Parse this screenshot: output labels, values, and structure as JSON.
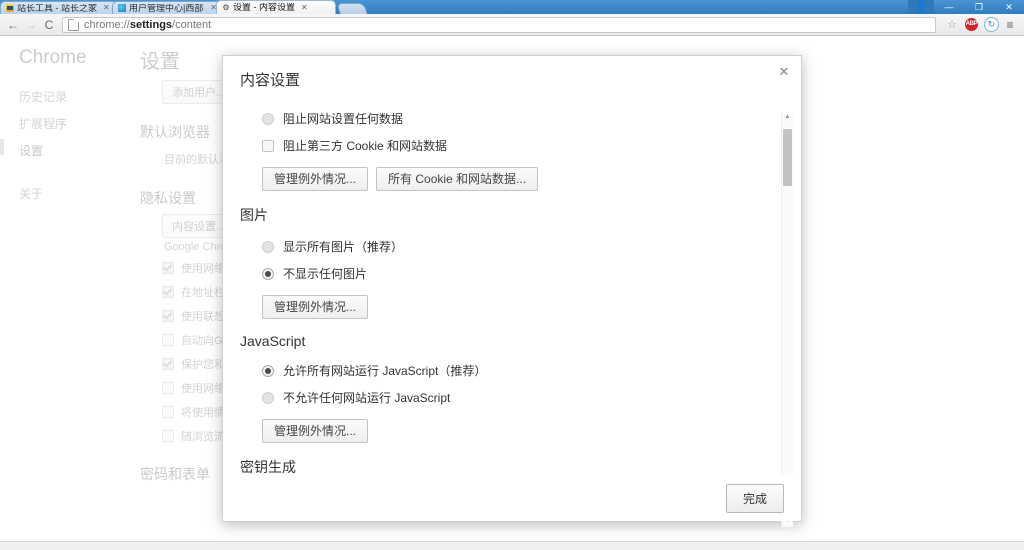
{
  "window": {
    "controls": {
      "user_icon": "user-account-icon",
      "minimize": "—",
      "maximize": "❐",
      "close": "✕"
    }
  },
  "tabs": [
    {
      "title": "站长工具 - 站长之家",
      "favicon": "site-tool-icon",
      "close": "✕",
      "active": false
    },
    {
      "title": "用户管理中心|西部数",
      "favicon": "user-center-icon",
      "close": "✕",
      "active": false
    },
    {
      "title": "设置 - 内容设置",
      "favicon": "gear-icon",
      "close": "✕",
      "active": true
    }
  ],
  "toolbar": {
    "back": "←",
    "forward": "→",
    "reload": "C",
    "url_prefix": "chrome://",
    "url_bold": "settings",
    "url_suffix": "/content",
    "star": "☆",
    "abp_label": "ABP",
    "sync": "↻",
    "menu": "≡"
  },
  "settings_page": {
    "brand": "Chrome",
    "nav": [
      {
        "label": "历史记录",
        "selected": false
      },
      {
        "label": "扩展程序",
        "selected": false
      },
      {
        "label": "设置",
        "selected": true
      },
      {
        "label": "关于",
        "selected": false
      }
    ],
    "title": "设置",
    "add_user_button": "添加用户...",
    "default_browser_heading": "默认浏览器",
    "default_browser_text": "目前的默认浏",
    "privacy_heading": "隐私设置",
    "content_settings_button": "内容设置...",
    "privacy_note": "Google Chro",
    "checkboxes": [
      {
        "label": "使用网络",
        "checked": true
      },
      {
        "label": "在地址栏",
        "checked": true
      },
      {
        "label": "使用联想",
        "checked": true
      },
      {
        "label": "自动向G",
        "checked": false
      },
      {
        "label": "保护您和",
        "checked": true
      },
      {
        "label": "使用网络",
        "checked": false
      },
      {
        "label": "将使用情",
        "checked": false
      },
      {
        "label": "随浏览流",
        "checked": false
      }
    ],
    "passwords_heading": "密码和表单"
  },
  "dialog": {
    "title": "内容设置",
    "close_label": "✕",
    "sections": [
      {
        "heading": null,
        "options": [
          {
            "type": "radio",
            "label": "阻止网站设置任何数据",
            "checked": false
          },
          {
            "type": "checkbox",
            "label": "阻止第三方 Cookie 和网站数据",
            "checked": false
          }
        ],
        "buttons": [
          "管理例外情况...",
          "所有 Cookie 和网站数据..."
        ]
      },
      {
        "heading": "图片",
        "options": [
          {
            "type": "radio",
            "label": "显示所有图片（推荐）",
            "checked": false
          },
          {
            "type": "radio",
            "label": "不显示任何图片",
            "checked": true
          }
        ],
        "buttons": [
          "管理例外情况..."
        ]
      },
      {
        "heading": "JavaScript",
        "options": [
          {
            "type": "radio",
            "label": "允许所有网站运行 JavaScript（推荐）",
            "checked": true
          },
          {
            "type": "radio",
            "label": "不允许任何网站运行 JavaScript",
            "checked": false
          }
        ],
        "buttons": [
          "管理例外情况..."
        ]
      },
      {
        "heading": "密钥生成",
        "options": [],
        "buttons": []
      }
    ],
    "scrollbar": {
      "up_arrow": "▲",
      "down_arrow": "▼"
    },
    "done_button": "完成"
  }
}
